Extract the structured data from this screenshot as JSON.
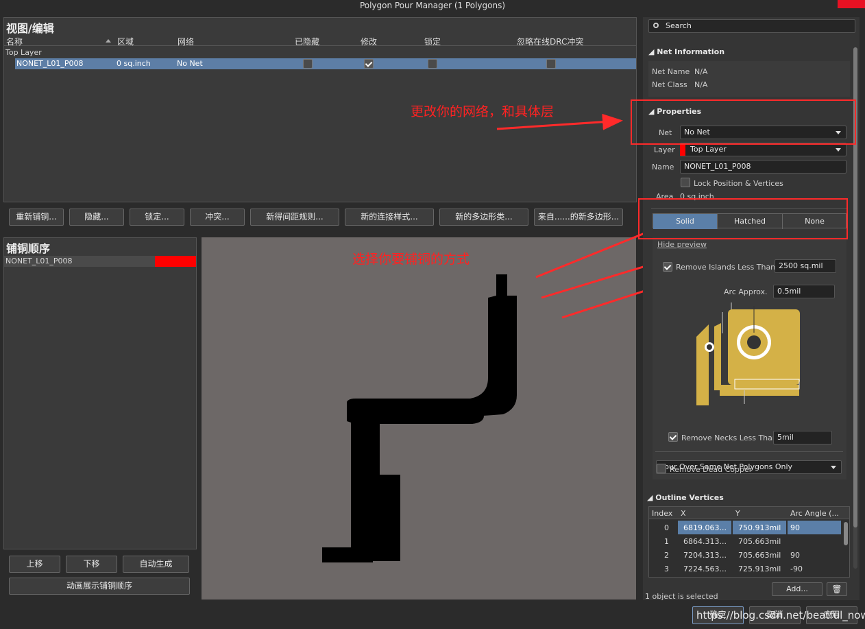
{
  "window": {
    "title": "Polygon Pour Manager (1 Polygons)"
  },
  "view_edit": {
    "title": "视图/编辑",
    "columns": [
      "名称",
      "区域",
      "网络",
      "已隐藏",
      "修改",
      "锁定",
      "忽略在线DRC冲突"
    ],
    "group": "Top Layer",
    "row": {
      "name": "NONET_L01_P008",
      "area": "0 sq.inch",
      "net": "No Net",
      "hidden": false,
      "modified": true,
      "locked": false,
      "ignore_drc": false
    }
  },
  "action_buttons": [
    "重新铺铜...",
    "隐藏...",
    "锁定...",
    "冲突...",
    "新得间距规则...",
    "新的连接样式...",
    "新的多边形类...",
    "来自......的新多边形..."
  ],
  "pour_order": {
    "title": "铺铜顺序",
    "item": "NONET_L01_P008",
    "item_color": "#ff0000",
    "buttons": [
      "上移",
      "下移",
      "自动生成"
    ],
    "animate_button": "动画展示铺铜顺序"
  },
  "annotations": {
    "net_note": "更改你的网络，和具体层",
    "fill_note": "选择你要铺铜的方式"
  },
  "right": {
    "search_placeholder": "Search",
    "net_info": {
      "title": "Net Information",
      "net_name_label": "Net Name",
      "net_name": "N/A",
      "net_class_label": "Net Class",
      "net_class": "N/A"
    },
    "properties": {
      "title": "Properties",
      "net_label": "Net",
      "net_value": "No Net",
      "layer_label": "Layer",
      "layer_value": "Top Layer",
      "layer_color": "#ff0000",
      "name_label": "Name",
      "name_value": "NONET_L01_P008",
      "lock_label": "Lock Position & Vertices",
      "area_label": "Area",
      "area_value": "0 sq.inch"
    },
    "fill_modes": [
      "Solid",
      "Hatched",
      "None"
    ],
    "fill_selected": "Solid",
    "hide_preview": "Hide preview",
    "remove_islands_label": "Remove Islands Less Than",
    "remove_islands_value": "2500 sq.mil",
    "arc_approx_label": "Arc Approx.",
    "arc_approx_value": "0.5mil",
    "remove_necks_label": "Remove Necks Less Than",
    "remove_necks_value": "5mil",
    "pour_over": "Pour Over Same Net Polygons Only",
    "remove_dead_label": "Remove Dead Copper",
    "outline": {
      "title": "Outline Vertices",
      "headers": [
        "Index",
        "X",
        "Y",
        "Arc Angle (..."
      ],
      "rows": [
        [
          "0",
          "6819.063...",
          "750.913mil",
          "90"
        ],
        [
          "1",
          "6864.313...",
          "705.663mil",
          ""
        ],
        [
          "2",
          "7204.313...",
          "705.663mil",
          "90"
        ],
        [
          "3",
          "7224.563...",
          "725.913mil",
          "-90"
        ]
      ]
    },
    "add_button": "Add...",
    "status": "1 object is selected"
  },
  "footer": {
    "ok": "确定",
    "cancel": "取消",
    "apply": "应用",
    "watermark": "https://blog.csdn.net/beatful_now"
  }
}
